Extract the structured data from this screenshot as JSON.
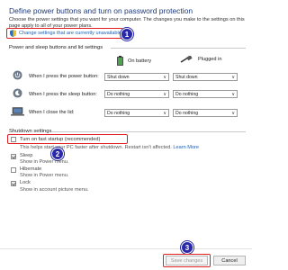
{
  "header": {
    "title": "Define power buttons and turn on password protection",
    "description": "Choose the power settings that you want for your computer. The changes you make to the settings on this page apply to all of your power plans."
  },
  "change_link": {
    "label": "Change settings that are currently unavailable"
  },
  "badges": [
    "1",
    "2",
    "3"
  ],
  "power_section": {
    "title": "Power and sleep buttons and lid settings",
    "col_battery": "On battery",
    "col_plugged": "Plugged in",
    "rows": [
      {
        "label": "When I press the power button:",
        "battery": "Shut down",
        "plugged": "Shut down",
        "icon": "power-icon"
      },
      {
        "label": "When I press the sleep button:",
        "battery": "Do nothing",
        "plugged": "Do nothing",
        "icon": "sleep-icon"
      },
      {
        "label": "When I close the lid:",
        "battery": "Do nothing",
        "plugged": "Do nothing",
        "icon": "lid-icon"
      }
    ]
  },
  "shutdown_section": {
    "title": "Shutdown settings",
    "fast_startup": {
      "label": "Turn on fast startup (recommended)",
      "sub": "This helps start your PC faster after shutdown. Restart isn't affected.",
      "learn_more": "Learn More"
    },
    "items": [
      {
        "label": "Sleep",
        "sub": "Show in Power menu.",
        "checked": true
      },
      {
        "label": "Hibernate",
        "sub": "Show in Power menu.",
        "checked": false
      },
      {
        "label": "Lock",
        "sub": "Show in account picture menu.",
        "checked": true
      }
    ]
  },
  "footer": {
    "save": "Save changes",
    "cancel": "Cancel"
  },
  "colors": {
    "highlight": "#e02020",
    "badge": "#2a2aa8",
    "link": "#1a5fb4",
    "title": "#1e3a78"
  }
}
